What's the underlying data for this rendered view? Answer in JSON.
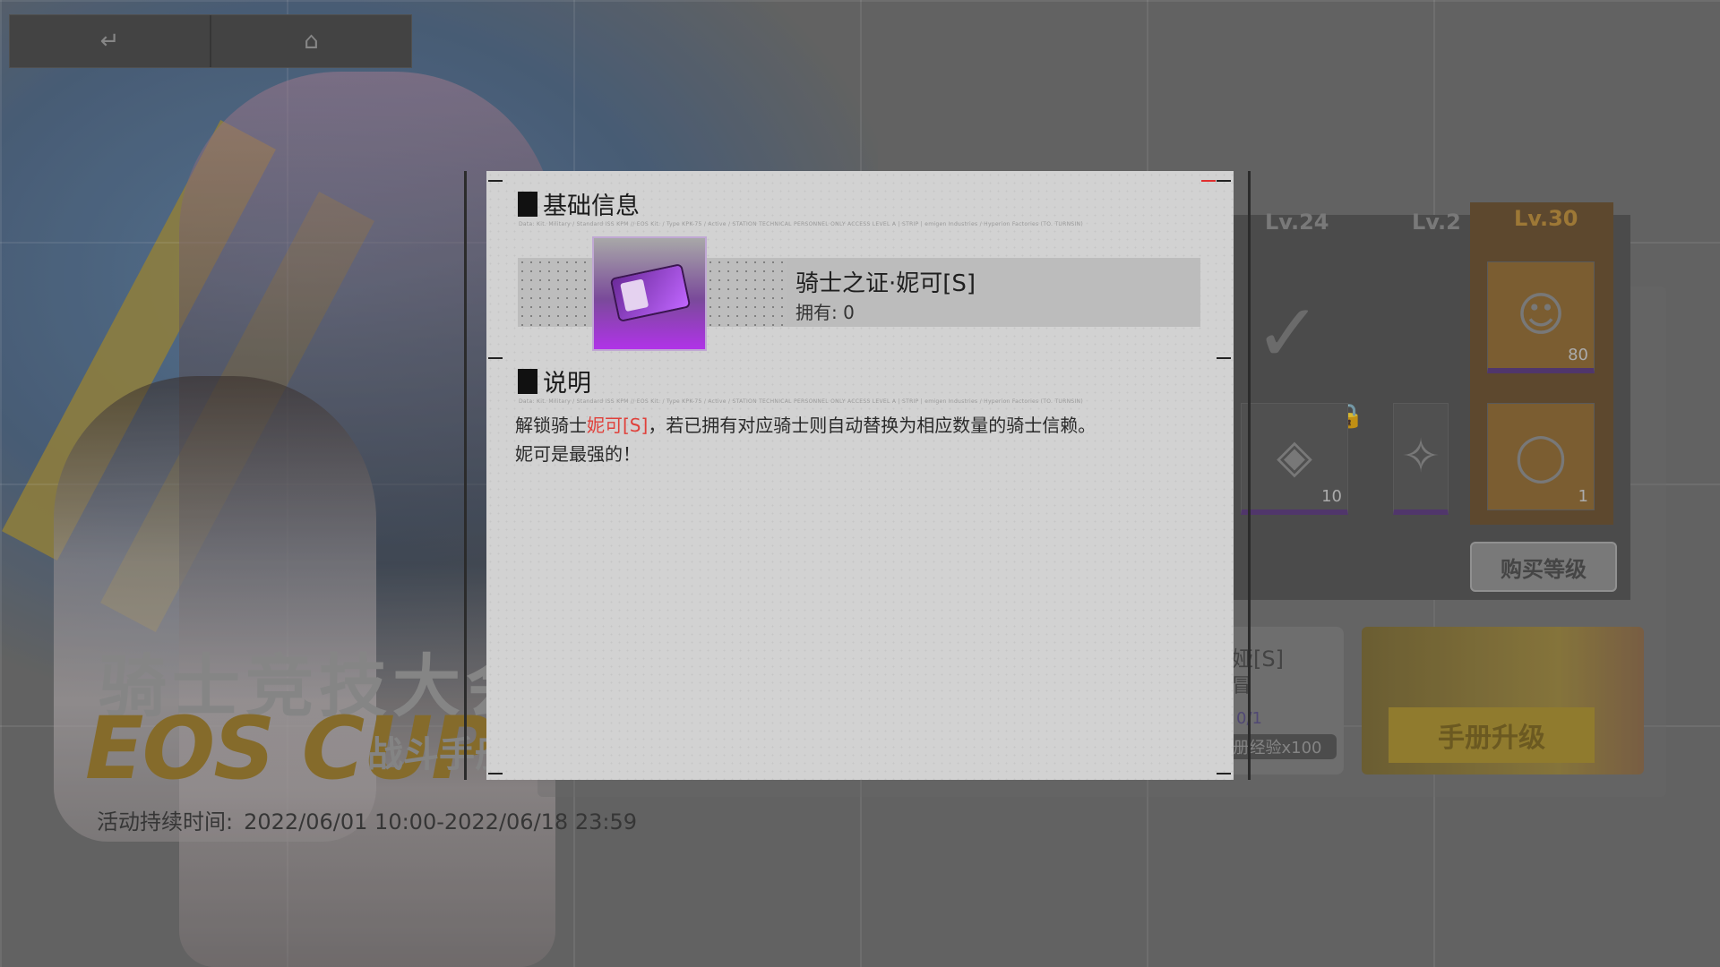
{
  "nav": {
    "back_icon": "back-arrow-icon",
    "home_icon": "home-icon"
  },
  "event": {
    "title_cn": "骑士竞技大会",
    "title_en": "EOS CUP",
    "subtitle": "战斗手册",
    "time_label": "活动持续时间:",
    "time_range": "2022/06/01 10:00-2022/06/18 23:59"
  },
  "rewards": {
    "levels": [
      "Lv.24",
      "Lv.2",
      "Lv.30"
    ],
    "quantities": [
      "10",
      "80",
      "1"
    ],
    "buy_button": "购买等级"
  },
  "task": {
    "title": "娅[S]",
    "subtitle": "冒",
    "progress": "0/1",
    "reward": "册经验x100"
  },
  "upgrade_button": "手册升级",
  "modal": {
    "section1_title": "基础信息",
    "section2_title": "说明",
    "fine_print": "Data: Kit. Military / Standard ISS KPM // EOS Kit. / Type KPK-75 / Active  /  STATION TECHNICAL PERSONNEL  ONLY   ACCESS LEVEL  A  | STRIP | emigen Industries / Hyperion Factories (TO. TURNSIN)",
    "item": {
      "name": "骑士之证·妮可[S]",
      "owned_label": "拥有: 0"
    },
    "description": {
      "line1_pre": "解锁骑士",
      "line1_hl": "妮可[S]",
      "line1_post": "，若已拥有对应骑士则自动替换为相应数量的骑士信赖。",
      "line2": "妮可是最强的！"
    }
  },
  "colors": {
    "accent_purple": "#b033e8",
    "highlight_red": "#e0403a",
    "modal_bg": "#d2d2d2"
  }
}
